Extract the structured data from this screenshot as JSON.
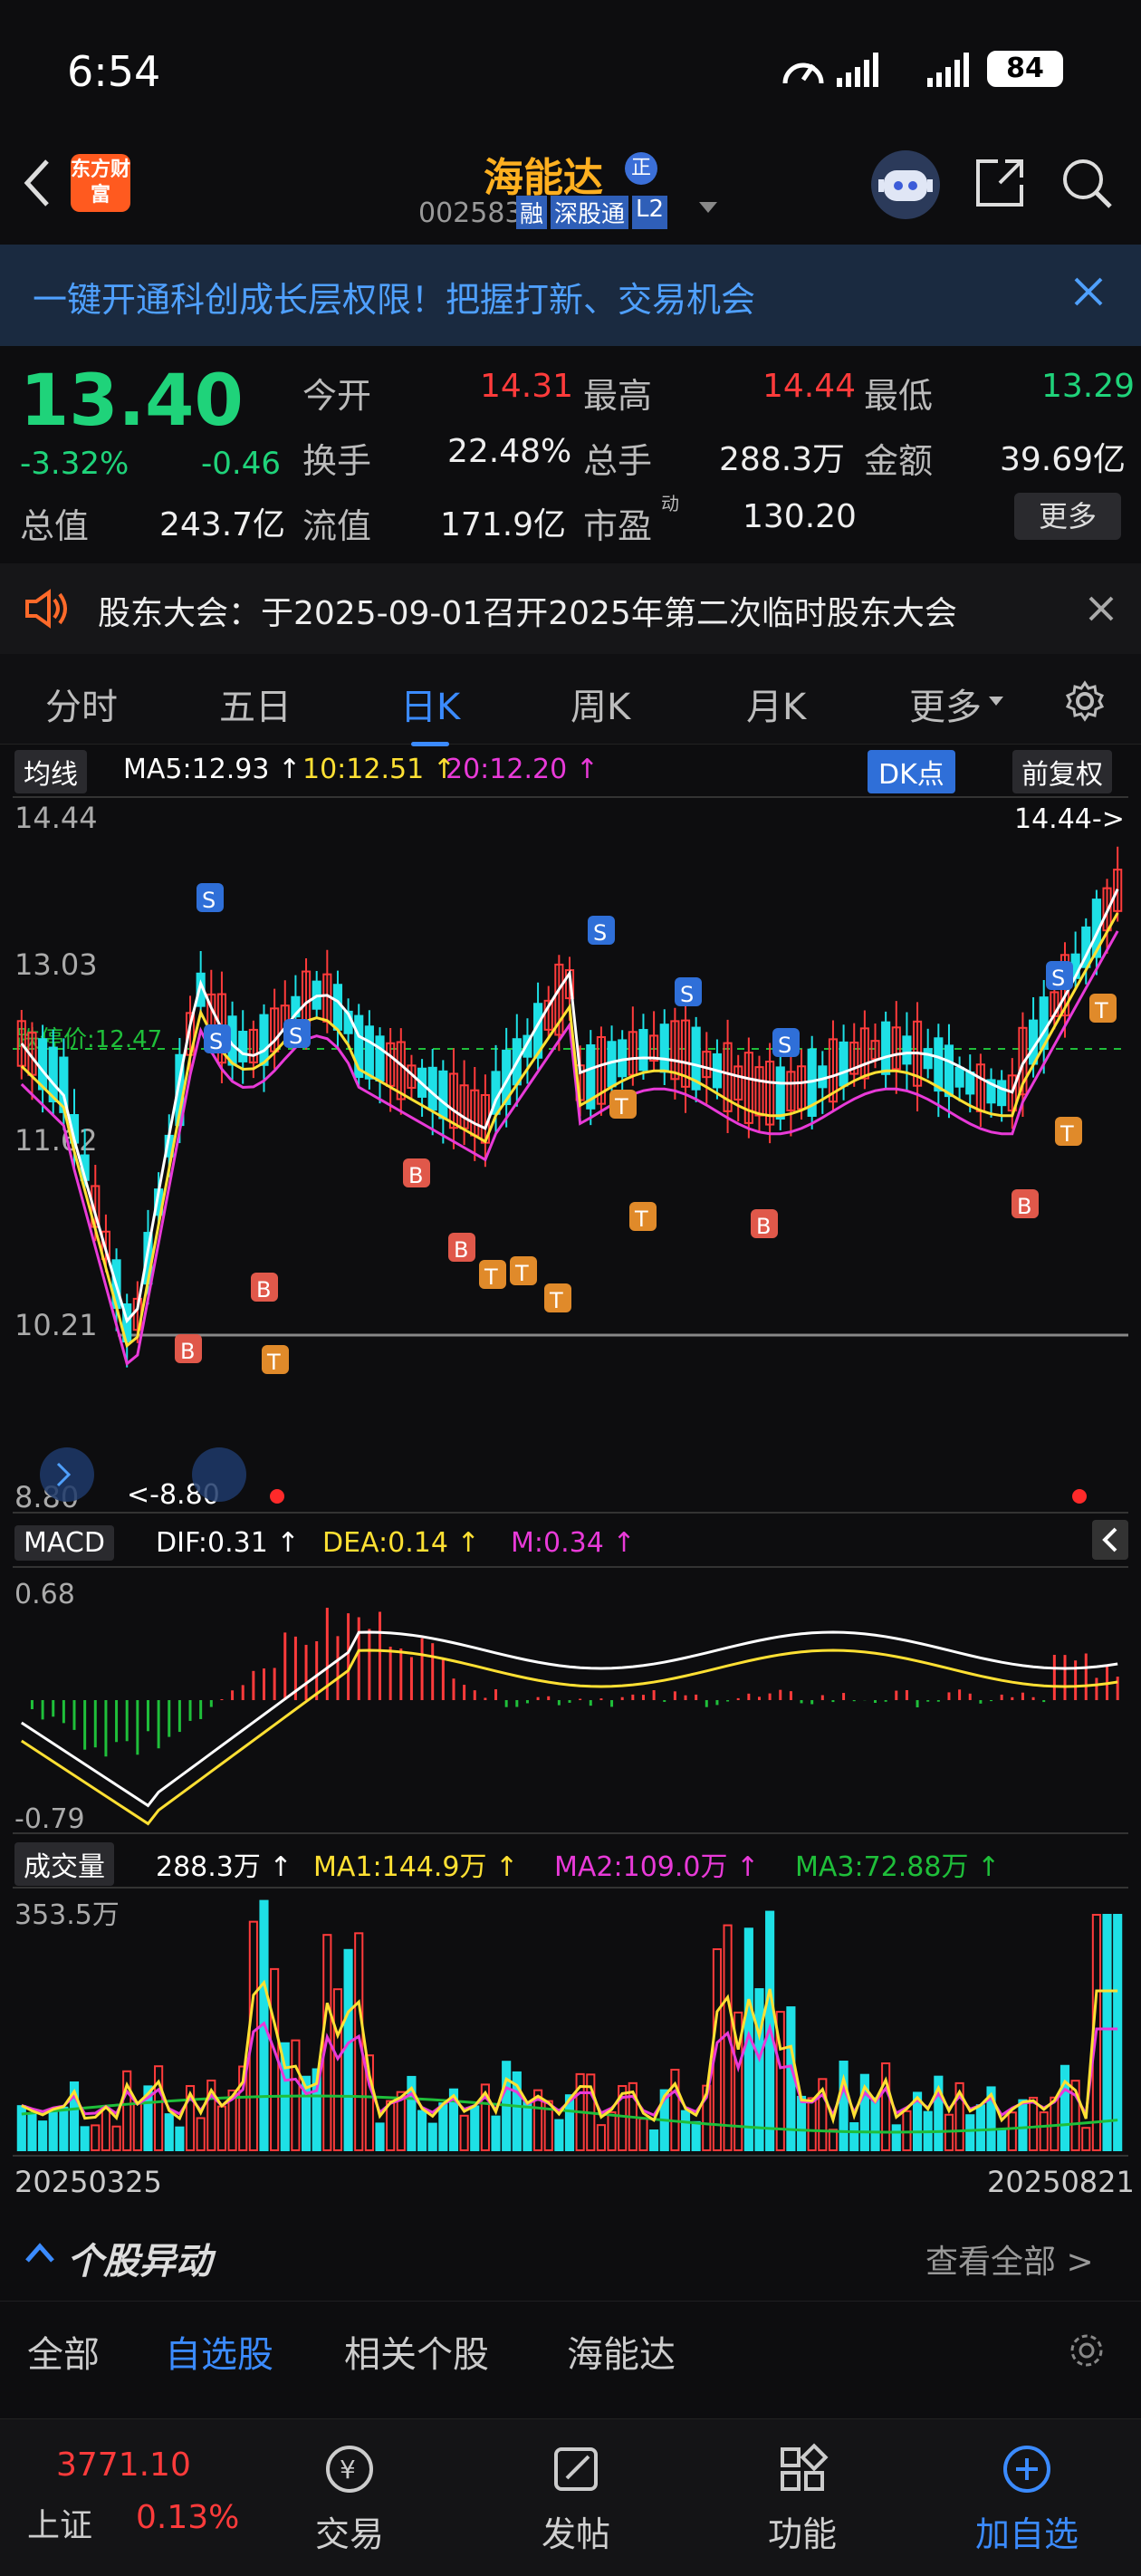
{
  "status": {
    "time": "6:54",
    "battery": "84"
  },
  "header": {
    "app_logo": "东方财富",
    "stock_name": "海能达",
    "badge": "正",
    "code": "002583",
    "tags": [
      "融",
      "深股通",
      "L2"
    ]
  },
  "banner": {
    "text": "一键开通科创成长层权限！把握打新、交易机会"
  },
  "quote": {
    "price": "13.40",
    "change_pct": "-3.32%",
    "change": "-0.46",
    "fields": [
      {
        "label": "今开",
        "value": "14.31",
        "color": "red"
      },
      {
        "label": "最高",
        "value": "14.44",
        "color": "red"
      },
      {
        "label": "最低",
        "value": "13.29",
        "color": "green"
      },
      {
        "label": "换手",
        "value": "22.48%",
        "color": "white"
      },
      {
        "label": "总手",
        "value": "288.3万",
        "color": "white"
      },
      {
        "label": "金额",
        "value": "39.69亿",
        "color": "white"
      },
      {
        "label": "总值",
        "value": "243.7亿",
        "color": "white"
      },
      {
        "label": "流值",
        "value": "171.9亿",
        "color": "white"
      },
      {
        "label": "市盈",
        "value": "130.20",
        "color": "white",
        "sup": "动"
      }
    ],
    "more_label": "更多"
  },
  "notice": {
    "text": "股东大会：于2025-09-01召开2025年第二次临时股东大会"
  },
  "tabs": [
    "分时",
    "五日",
    "日K",
    "周K",
    "月K",
    "更多"
  ],
  "active_tab": "日K",
  "kline": {
    "indicator_label": "均线",
    "ma5": "MA5:12.93 ↑",
    "ma10": "10:12.51 ↑",
    "ma20": "20:12.20 ↑",
    "dk_label": "DK点",
    "adjust_label": "前复权",
    "y_labels": [
      "14.44",
      "13.03",
      "11.62",
      "10.21",
      "8.80"
    ],
    "high_marker": "14.44->",
    "low_marker": "<-8.80",
    "limit_down": "跌停价:12.47"
  },
  "macd": {
    "label": "MACD",
    "dif": "DIF:0.31 ↑",
    "dea": "DEA:0.14 ↑",
    "m": "M:0.34 ↑",
    "y_labels": [
      "0.68",
      "-0.79"
    ]
  },
  "volume": {
    "label": "成交量",
    "value": "288.3万 ↑",
    "ma1": "MA1:144.9万 ↑",
    "ma2": "MA2:109.0万 ↑",
    "ma3": "MA3:72.88万 ↑",
    "max_label": "353.5万",
    "start_date": "20250325",
    "end_date": "20250821"
  },
  "section": {
    "title": "个股异动",
    "link": "查看全部 >"
  },
  "filters": [
    "全部",
    "自选股",
    "相关个股",
    "海能达"
  ],
  "active_filter": "自选股",
  "bottom": {
    "index_value": "3771.10",
    "index_name": "上证",
    "index_pct": "0.13%",
    "items": [
      "交易",
      "发帖",
      "功能",
      "加自选"
    ]
  },
  "colors": {
    "up": "#ff3b3b",
    "down": "#1ee0e6",
    "accent": "#3b8bff",
    "ma5": "#ffffff",
    "ma10": "#ffe033",
    "ma20": "#e83ad8"
  }
}
